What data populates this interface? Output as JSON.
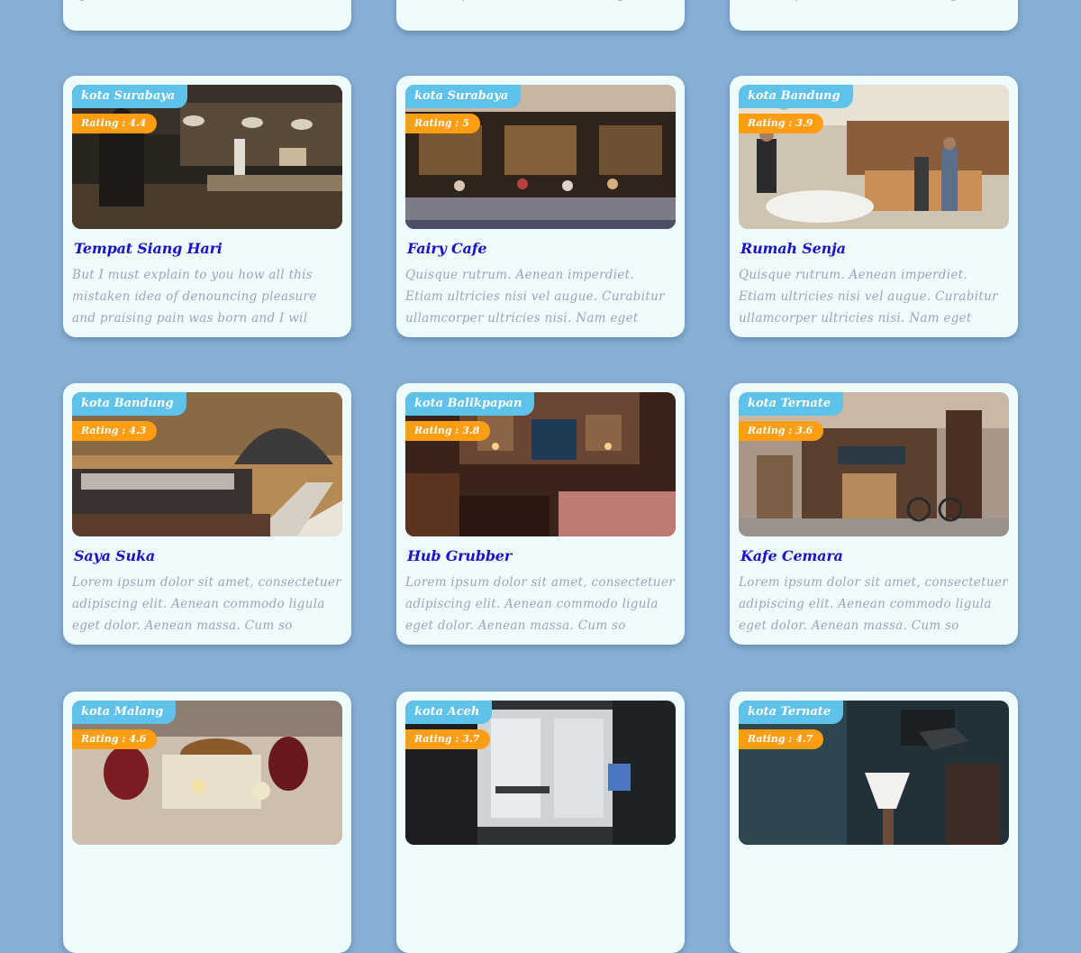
{
  "cards": [
    {
      "city": "",
      "rating": "",
      "title": "",
      "desc": "eget dolor. Aenean massa. Cum so",
      "photo": "cafe"
    },
    {
      "city": "",
      "rating": "",
      "title": "",
      "desc": "ullamcorper ultricies nisi. Nam eget",
      "photo": "cafe"
    },
    {
      "city": "",
      "rating": "",
      "title": "",
      "desc": "ullamcorper ultricies nisi. Nam eget",
      "photo": "cafe"
    },
    {
      "city": "kota Surabaya",
      "rating": "Rating : 4.4",
      "title": "Tempat Siang Hari",
      "desc": "But I must explain to you how all this mistaken idea of denouncing pleasure and praising pain was born and I wil",
      "photo": "kitchen"
    },
    {
      "city": "kota Surabaya",
      "rating": "Rating : 5",
      "title": "Fairy Cafe",
      "desc": "Quisque rutrum. Aenean imperdiet. Etiam ultricies nisi vel augue. Curabitur ullamcorper ultricies nisi. Nam eget",
      "photo": "storefront"
    },
    {
      "city": "kota Bandung",
      "rating": "Rating : 3.9",
      "title": "Rumah Senja",
      "desc": "Quisque rutrum. Aenean imperdiet. Etiam ultricies nisi vel augue. Curabitur ullamcorper ultricies nisi. Nam eget",
      "photo": "coffee-bar"
    },
    {
      "city": "kota Bandung",
      "rating": "Rating : 4.3",
      "title": "Saya Suka",
      "desc": "Lorem ipsum dolor sit amet, consectetuer adipiscing elit. Aenean commodo ligula eget dolor. Aenean massa. Cum so",
      "photo": "hall"
    },
    {
      "city": "kota Balikpapan",
      "rating": "Rating : 3.8",
      "title": "Hub Grubber",
      "desc": "Lorem ipsum dolor sit amet, consectetuer adipiscing elit. Aenean commodo ligula eget dolor. Aenean massa. Cum so",
      "photo": "pub"
    },
    {
      "city": "kota Ternate",
      "rating": "Rating : 3.6",
      "title": "Kafe Cemara",
      "desc": "Lorem ipsum dolor sit amet, consectetuer adipiscing elit. Aenean commodo ligula eget dolor. Aenean massa. Cum so",
      "photo": "shop"
    },
    {
      "city": "kota Malang",
      "rating": "Rating : 4.6",
      "title": "",
      "desc": "",
      "photo": "food"
    },
    {
      "city": "kota Aceh",
      "rating": "Rating : 3.7",
      "title": "",
      "desc": "",
      "photo": "interior"
    },
    {
      "city": "kota Ternate",
      "rating": "Rating : 4.7",
      "title": "",
      "desc": "",
      "photo": "brew"
    }
  ]
}
